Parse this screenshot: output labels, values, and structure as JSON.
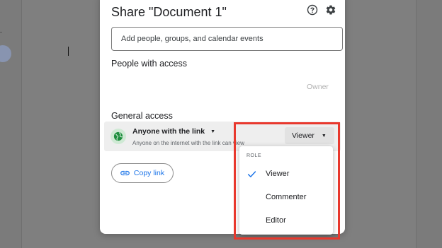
{
  "dialog": {
    "title": "Share \"Document 1\"",
    "help_icon": "help-circle-icon",
    "settings_icon": "gear-icon"
  },
  "add_people": {
    "placeholder": "Add people, groups, and calendar events"
  },
  "people_with_access": {
    "title": "People with access",
    "owner_label": "Owner"
  },
  "general_access": {
    "title": "General access",
    "link_setting": "Anyone with the link",
    "description": "Anyone on the internet with the link can view",
    "role": "Viewer",
    "icon": "globe-icon"
  },
  "copy_link": {
    "label": "Copy link",
    "icon": "link-icon"
  },
  "role_menu": {
    "header": "ROLE",
    "items": [
      {
        "label": "Viewer",
        "selected": true
      },
      {
        "label": "Commenter",
        "selected": false
      },
      {
        "label": "Editor",
        "selected": false
      }
    ]
  },
  "colors": {
    "accent": "#1a73e8",
    "highlight": "#e8382d",
    "globe_bg": "#cfe9d4",
    "globe": "#1e8e3e"
  }
}
